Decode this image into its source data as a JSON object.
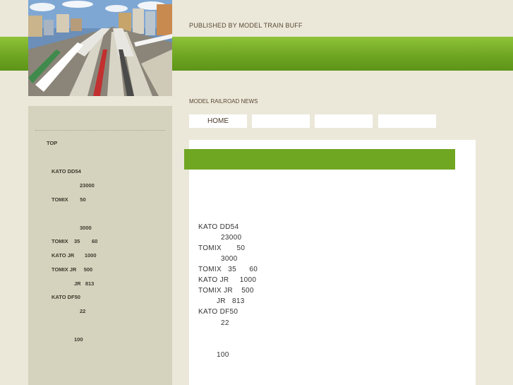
{
  "header": {
    "publisher": "PUBLISHED BY MODEL TRAIN BUFF",
    "site_name": "MODEL RAILROAD NEWS"
  },
  "nav": {
    "items": [
      {
        "label": "HOME"
      },
      {
        "label": ""
      },
      {
        "label": ""
      },
      {
        "label": ""
      }
    ]
  },
  "sidebar": {
    "top_label": "TOP",
    "items": [
      "KATO DD54",
      "23000",
      "TOMIX        50",
      "3000",
      "TOMIX    35        60",
      "KATO JR       1000",
      "TOMIX JR     500",
      "JR   813",
      "KATO DF50",
      "22",
      "100"
    ]
  },
  "content": {
    "lines": [
      "KATO DD54",
      "23000",
      "TOMIX       50",
      "3000",
      "TOMIX   35      60",
      "KATO JR     1000",
      "TOMIX JR    500",
      "JR   813",
      "KATO DF50",
      "22",
      "100"
    ]
  },
  "colors": {
    "background": "#ebe8da",
    "accent_green": "#6fa622",
    "sidebar": "#d5d3bd"
  }
}
